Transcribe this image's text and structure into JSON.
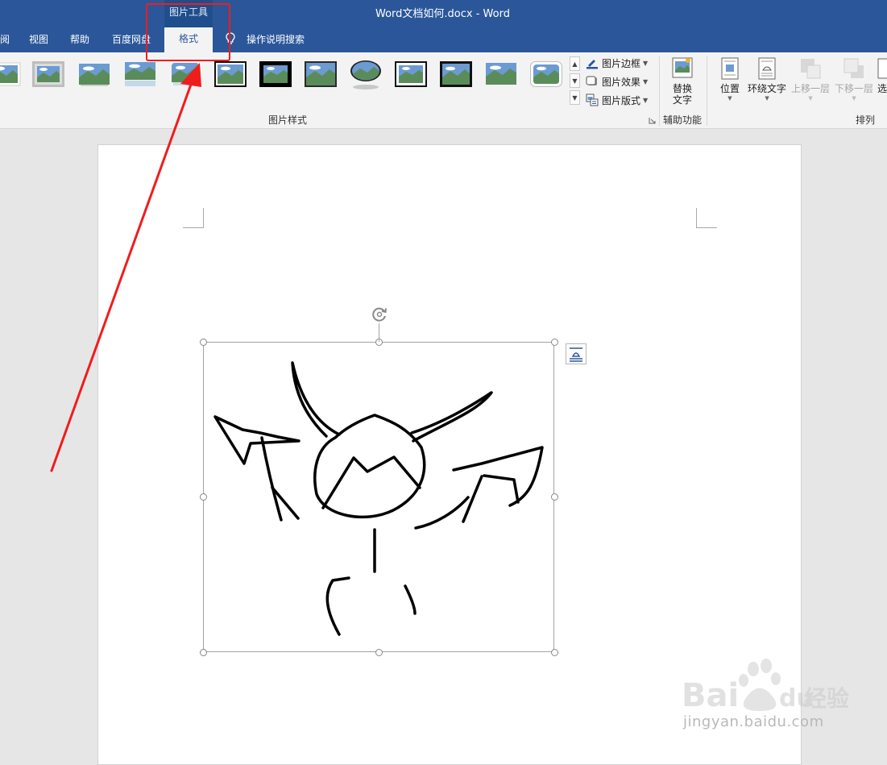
{
  "window": {
    "title": "Word文档如何.docx  -  Word"
  },
  "ribbon_tabs": {
    "review_partial": "阅",
    "view": "视图",
    "help": "帮助",
    "baidu_netdisk": "百度网盘",
    "context_group": "图片工具",
    "format": "格式",
    "tell_me": "操作说明搜索"
  },
  "picture_styles": {
    "group_label": "图片样式",
    "commands": {
      "border": "图片边框",
      "effects": "图片效果",
      "layout": "图片版式"
    },
    "thumbnails": [
      "picture-style-1",
      "picture-style-2",
      "picture-style-3",
      "picture-style-4",
      "picture-style-5",
      "picture-style-6",
      "picture-style-7",
      "picture-style-8",
      "picture-style-9",
      "picture-style-10",
      "picture-style-11",
      "picture-style-12",
      "picture-style-13"
    ]
  },
  "accessibility": {
    "group_label": "辅助功能",
    "alt_text_line1": "替换",
    "alt_text_line2": "文字"
  },
  "arrange": {
    "group_label": "排列",
    "position": "位置",
    "wrap_text": "环绕文字",
    "bring_forward": "上移一层",
    "send_backward": "下移一层",
    "selection_partial": "选"
  },
  "watermark": {
    "brand_word": "Bai",
    "brand_suffix": "du",
    "brand_cn": "经验",
    "url": "jingyan.baidu.com"
  },
  "colors": {
    "accent": "#2b579a",
    "annotation": "#f01d1d"
  }
}
